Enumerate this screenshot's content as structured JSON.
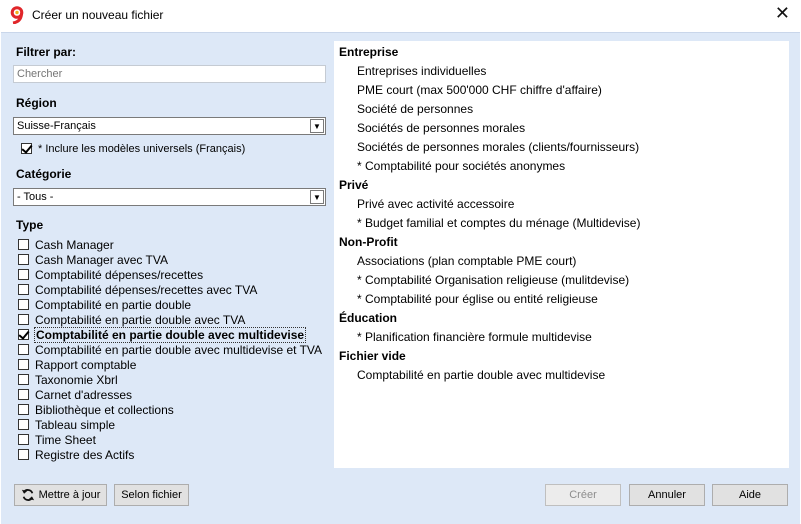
{
  "window": {
    "title": "Créer un nouveau fichier",
    "close_glyph": "✕"
  },
  "filter": {
    "label": "Filtrer par:",
    "placeholder": "Chercher"
  },
  "region": {
    "label": "Région",
    "selected": "Suisse-Français",
    "include_universal": {
      "label": "* Inclure les modèles universels (Français)",
      "checked": true
    }
  },
  "category": {
    "label": "Catégorie",
    "selected": "- Tous -"
  },
  "type": {
    "label": "Type",
    "items": [
      {
        "label": "Cash Manager",
        "checked": false
      },
      {
        "label": "Cash Manager avec TVA",
        "checked": false
      },
      {
        "label": "Comptabilité dépenses/recettes",
        "checked": false
      },
      {
        "label": "Comptabilité dépenses/recettes avec TVA",
        "checked": false
      },
      {
        "label": "Comptabilité en partie double",
        "checked": false
      },
      {
        "label": "Comptabilité en partie double avec TVA",
        "checked": false
      },
      {
        "label": "Comptabilité en partie double avec multidevise",
        "checked": true
      },
      {
        "label": "Comptabilité en partie double avec multidevise et TVA",
        "checked": false
      },
      {
        "label": "Rapport comptable",
        "checked": false
      },
      {
        "label": "Taxonomie Xbrl",
        "checked": false
      },
      {
        "label": "Carnet d'adresses",
        "checked": false
      },
      {
        "label": "Bibliothèque et collections",
        "checked": false
      },
      {
        "label": "Tableau simple",
        "checked": false
      },
      {
        "label": "Time Sheet",
        "checked": false
      },
      {
        "label": "Registre des Actifs",
        "checked": false
      }
    ]
  },
  "templates": [
    {
      "heading": "Entreprise",
      "items": [
        "Entreprises individuelles",
        "PME court (max 500'000 CHF chiffre d'affaire)",
        "Société de personnes",
        "Sociétés de personnes morales",
        "Sociétés de personnes morales (clients/fournisseurs)",
        "* Comptabilité pour sociétés anonymes"
      ]
    },
    {
      "heading": "Privé",
      "items": [
        "Privé avec activité accessoire",
        "* Budget familial et comptes du ménage (Multidevise)"
      ]
    },
    {
      "heading": "Non-Profit",
      "items": [
        "Associations (plan comptable PME court)",
        "* Comptabilité Organisation religieuse (mulitdevise)",
        "* Comptabilité pour église ou entité religieuse"
      ]
    },
    {
      "heading": "Éducation",
      "items": [
        "* Planification financière formule multidevise"
      ]
    },
    {
      "heading": "Fichier vide",
      "items": [
        "Comptabilité en partie double avec multidevise"
      ]
    }
  ],
  "buttons": {
    "update": "Mettre à jour",
    "by_file": "Selon fichier",
    "create": "Créer",
    "cancel": "Annuler",
    "help": "Aide"
  },
  "icons": {
    "app": "banana-logo-icon",
    "refresh": "refresh-icon",
    "dropdown": "chevron-down-icon",
    "close": "close-icon"
  }
}
